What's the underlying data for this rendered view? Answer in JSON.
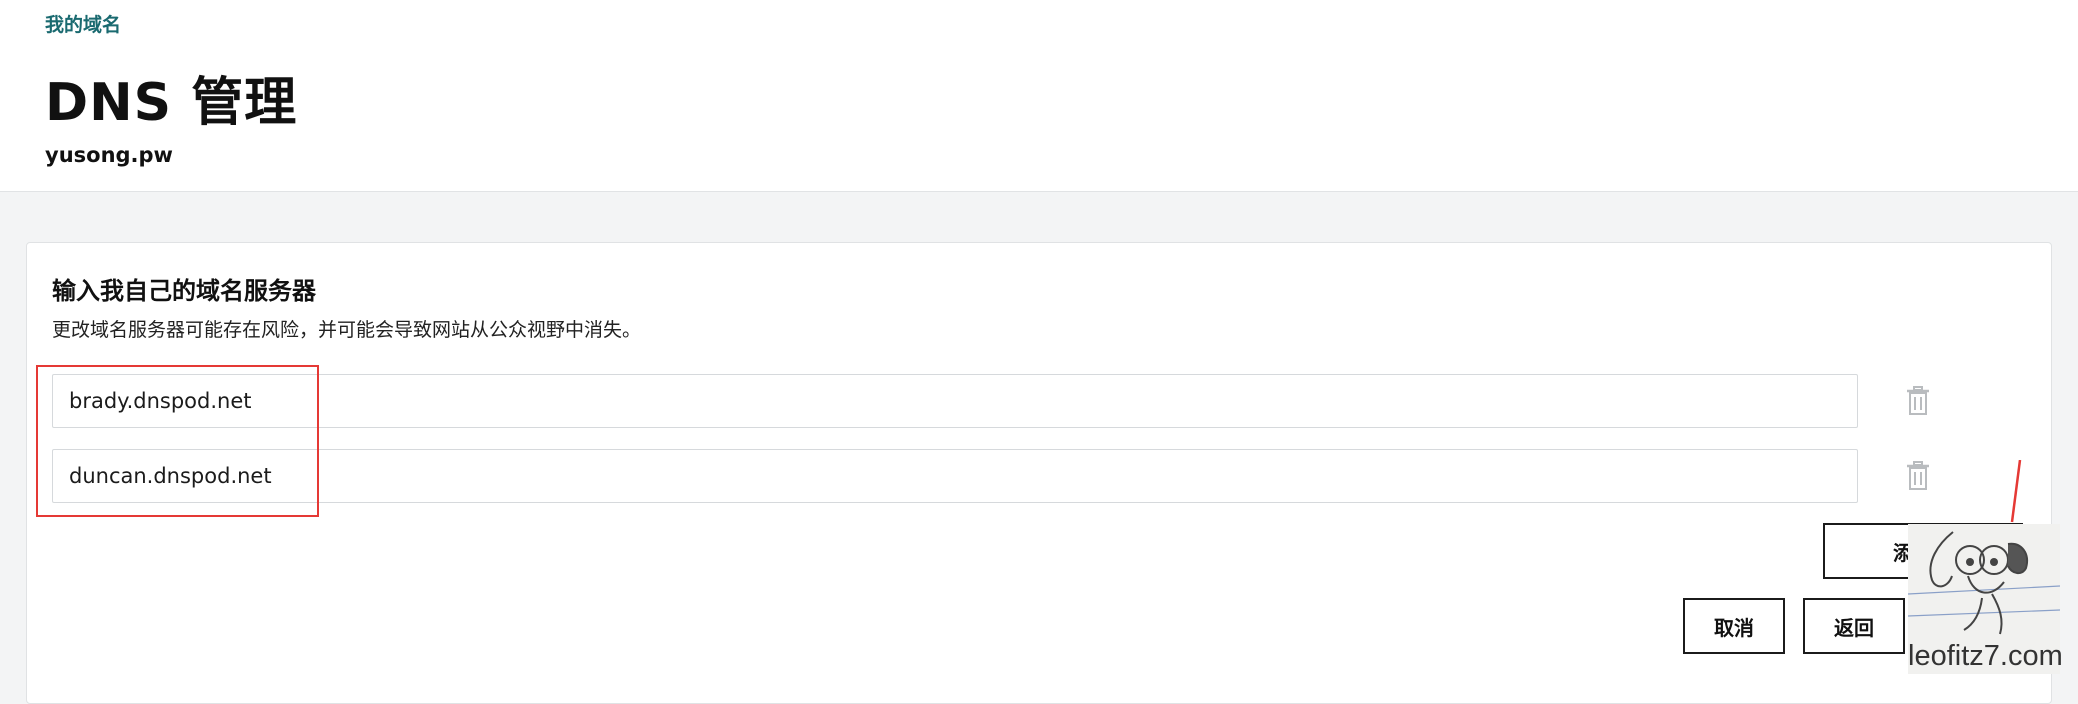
{
  "header": {
    "breadcrumb": "我的域名",
    "title": "DNS 管理",
    "domain": "yusong.pw"
  },
  "card": {
    "title": "输入我自己的域名服务器",
    "description": "更改域名服务器可能存在风险，并可能会导致网站从公众视野中消失。",
    "nameservers": [
      {
        "value": "brady.dnspod.net"
      },
      {
        "value": "duncan.dnspod.net"
      }
    ],
    "add_button": "添加域",
    "cancel_button": "取消",
    "back_button": "返回"
  },
  "watermark": {
    "text": "leofitz7.com"
  },
  "colors": {
    "breadcrumb": "#1a6a70",
    "highlight": "#e53935",
    "trash_icon": "#b9bcbf"
  }
}
